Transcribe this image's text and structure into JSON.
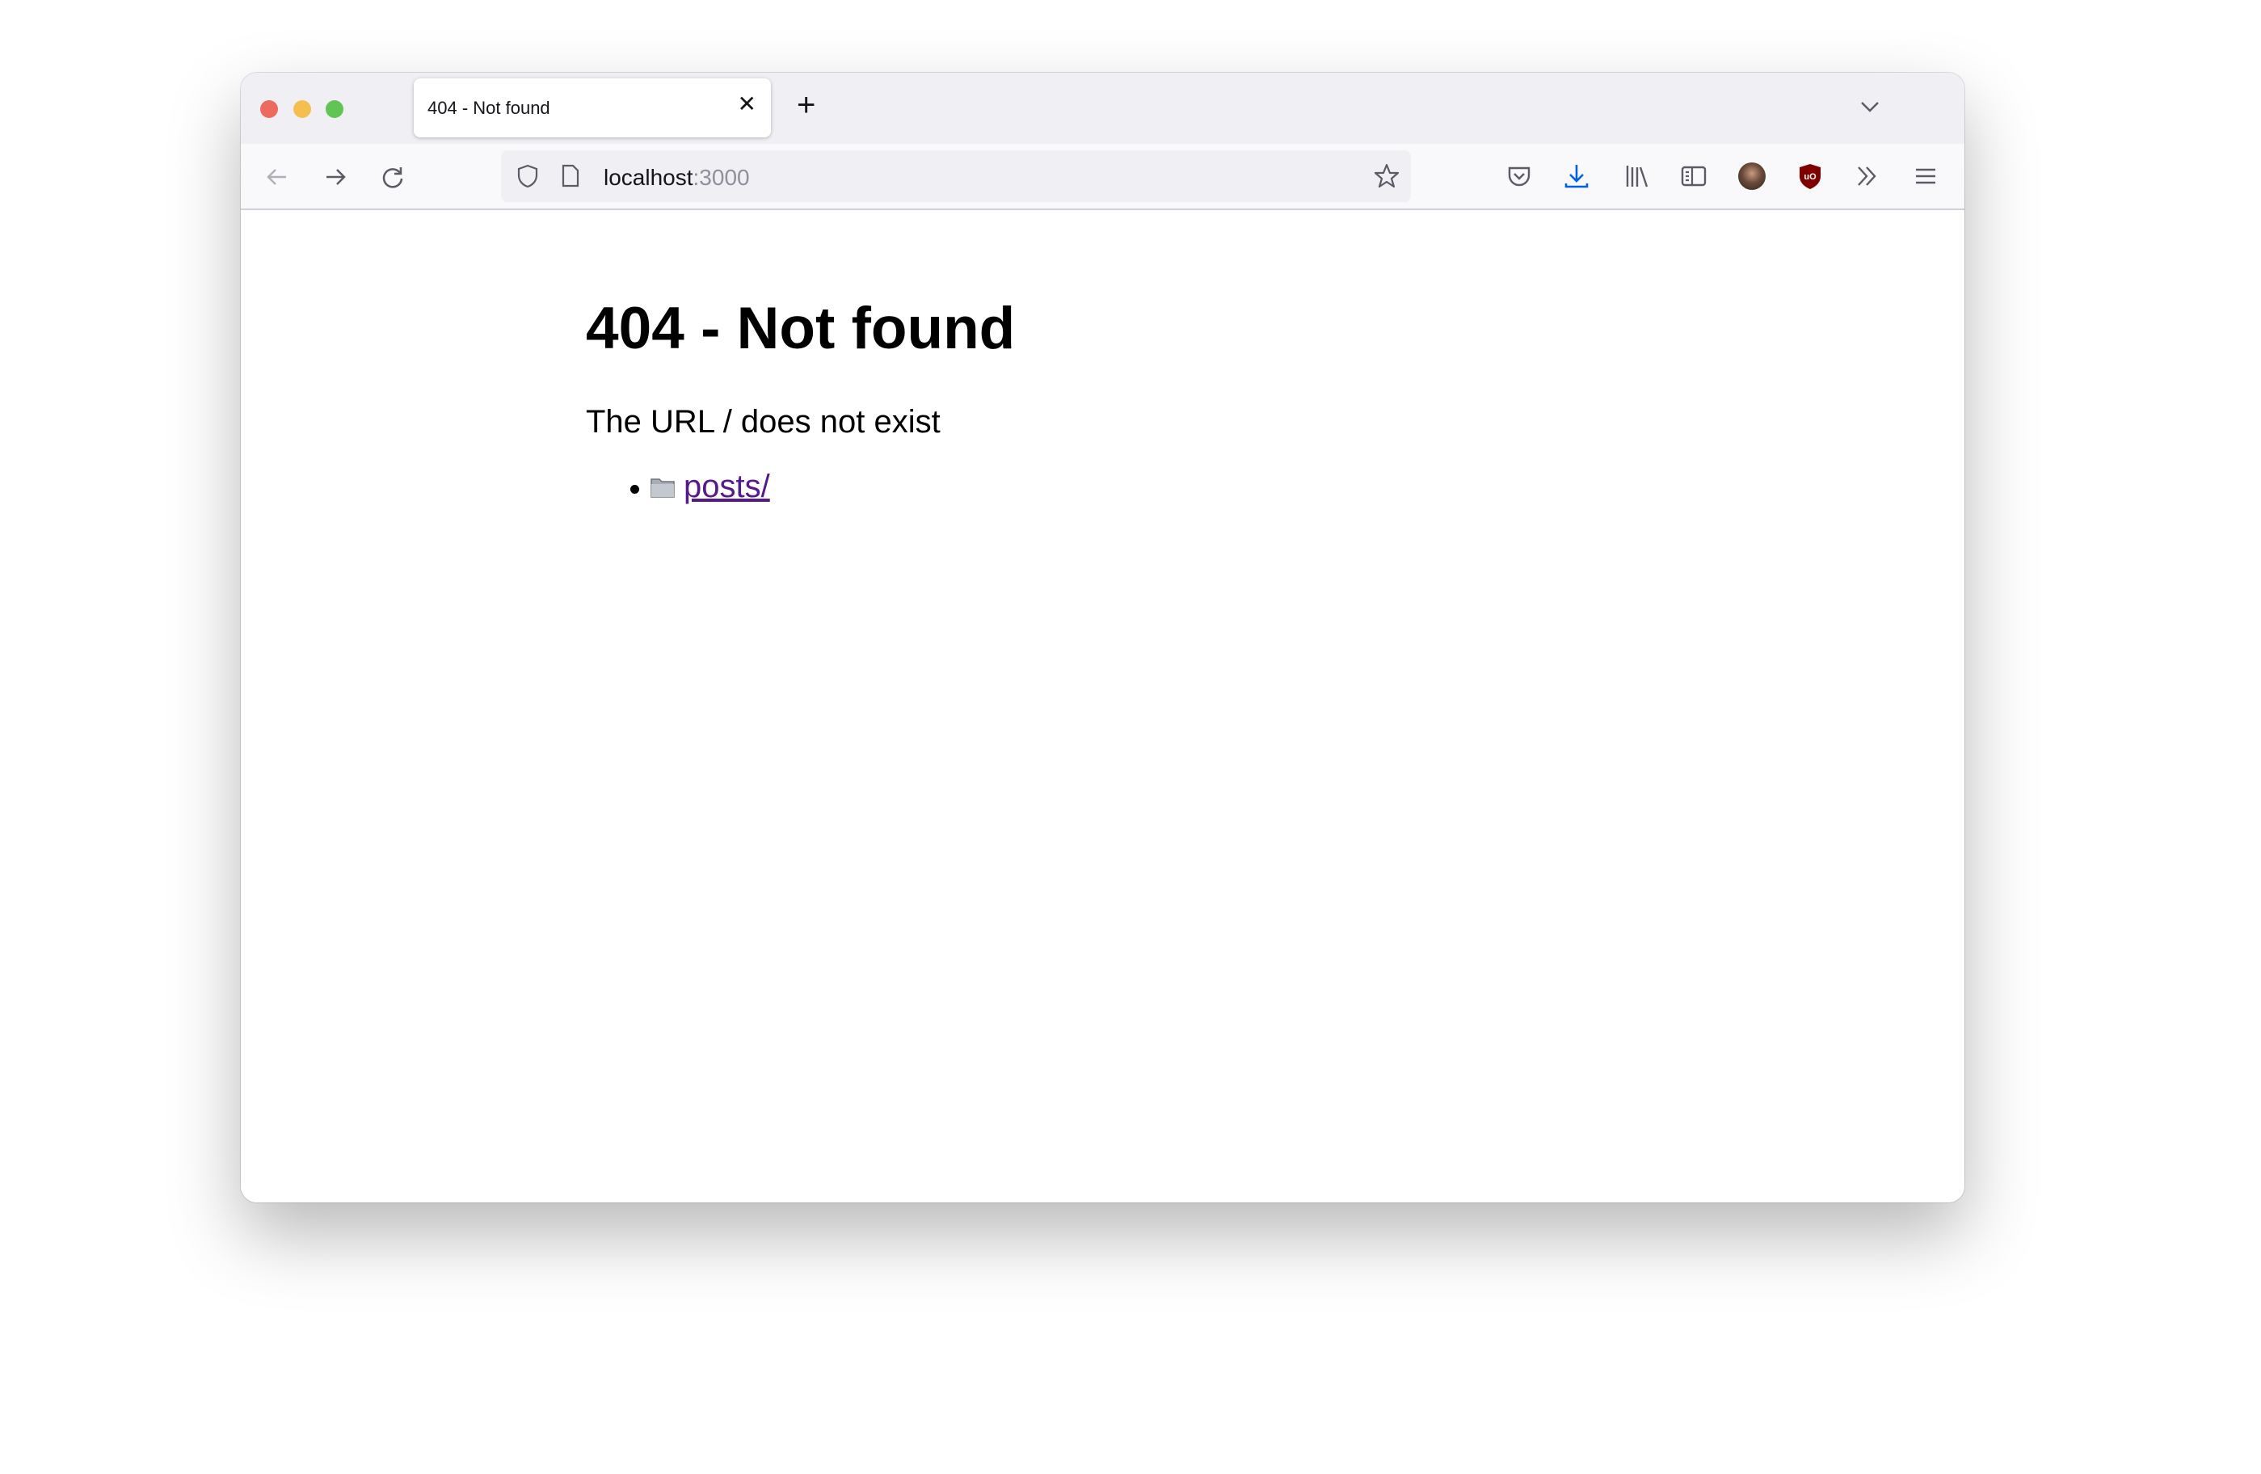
{
  "window": {
    "traffic_lights": {
      "close": "#ed6a5e",
      "minimize": "#f5bf4f",
      "zoom": "#61c554"
    }
  },
  "tabs": [
    {
      "title": "404 - Not found",
      "close_icon": "close-icon",
      "active": true
    }
  ],
  "tabbar": {
    "new_tab_icon": "plus-icon",
    "list_all_tabs_icon": "chevron-down-icon"
  },
  "toolbar": {
    "back_icon": "arrow-left-icon",
    "forward_icon": "arrow-right-icon",
    "reload_icon": "reload-icon",
    "url": {
      "host": "localhost",
      "port": ":3000"
    },
    "right_icons": [
      "pocket-icon",
      "download-icon",
      "library-icon",
      "sidebar-icon",
      "account-avatar",
      "ublock-origin-icon",
      "overflow-chevrons-icon",
      "hamburger-menu-icon"
    ],
    "download_color": "#0061e0",
    "ublock_color": "#800000"
  },
  "page": {
    "heading": "404 - Not found",
    "message": "The URL / does not exist",
    "links": [
      {
        "icon": "folder-icon",
        "label": "posts/"
      }
    ],
    "link_color": "#551a8b"
  }
}
